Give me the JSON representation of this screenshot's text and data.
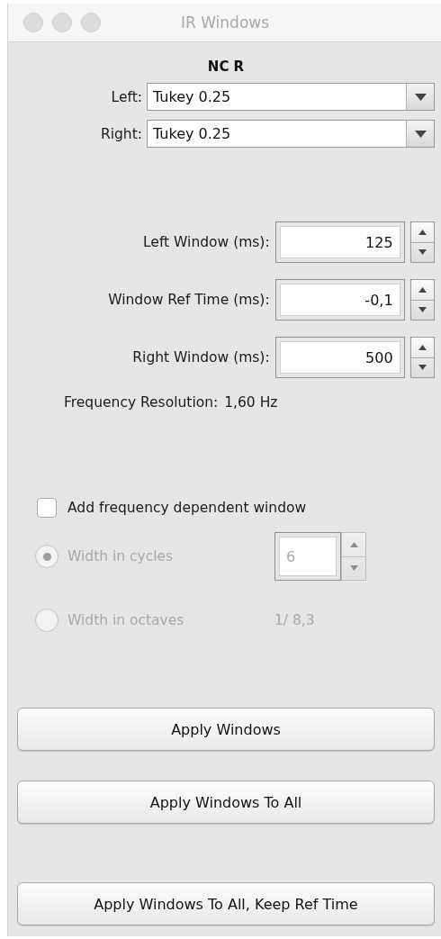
{
  "window": {
    "title": "IR Windows"
  },
  "heading": "NC R",
  "selectors": [
    {
      "label": "Left:",
      "value": "Tukey 0.25"
    },
    {
      "label": "Right:",
      "value": "Tukey 0.25"
    }
  ],
  "spinners": [
    {
      "label": "Left Window (ms):",
      "value": "125"
    },
    {
      "label": "Window Ref Time (ms):",
      "value": "-0,1"
    },
    {
      "label": "Right Window (ms):",
      "value": "500"
    }
  ],
  "frequency_resolution": {
    "label": "Frequency Resolution:",
    "value": "1,60 Hz"
  },
  "frequency_dependent": {
    "label": "Add frequency dependent window",
    "checked": false
  },
  "width_options": [
    {
      "kind": "spinner",
      "label": "Width in cycles",
      "selected": true,
      "disabled": true,
      "value": "6"
    },
    {
      "kind": "text",
      "label": "Width in octaves",
      "selected": false,
      "disabled": true,
      "value": "1/ 8,3"
    }
  ],
  "buttons": [
    "Apply Windows",
    "Apply Windows To All",
    "Apply Windows To All, Keep Ref Time"
  ]
}
